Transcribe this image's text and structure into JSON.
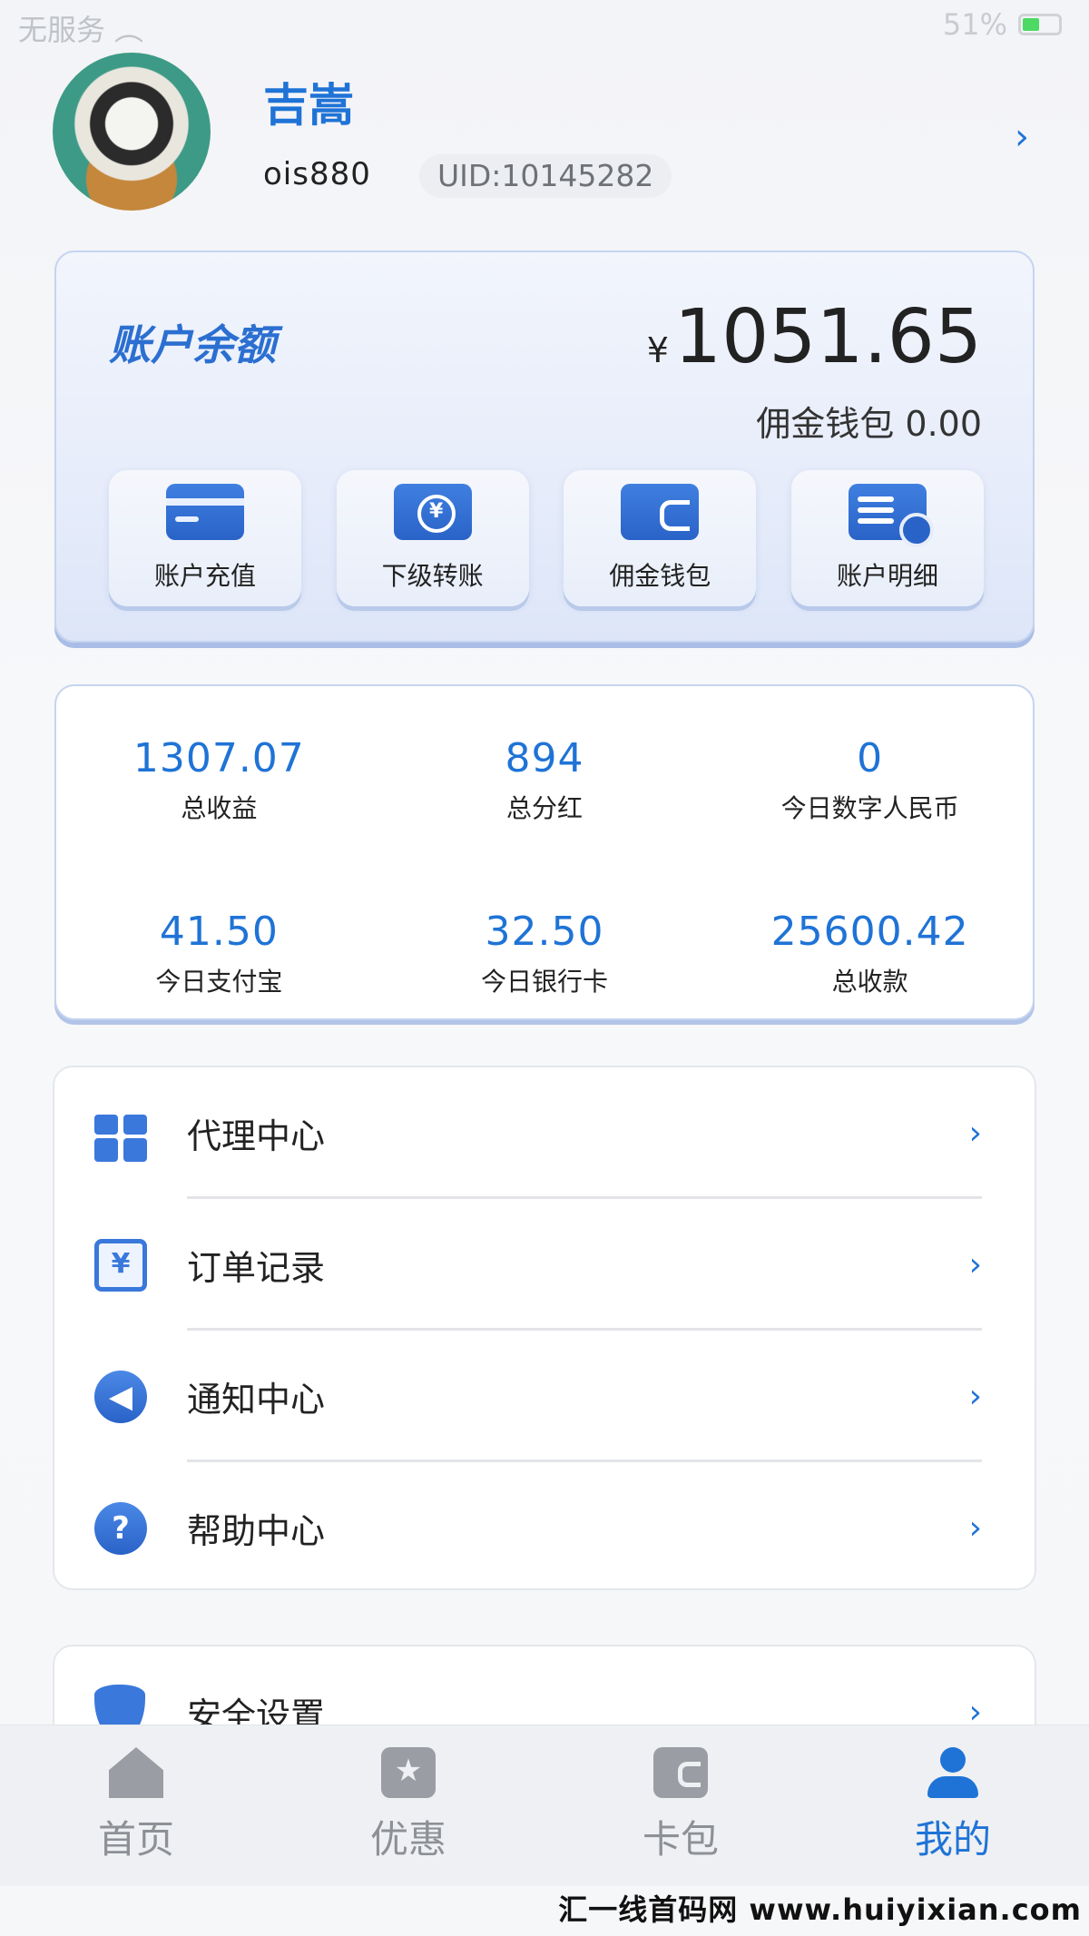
{
  "status_bar": {
    "carrier": "无服务",
    "battery": "51%"
  },
  "profile": {
    "name": "吉嵩",
    "username": "ois880",
    "uid": "UID:10145282"
  },
  "balance": {
    "title": "账户余额",
    "currency": "¥",
    "amount": "1051.65",
    "commission_label": "佣金钱包",
    "commission_value": "0.00",
    "actions": [
      {
        "label": "账户充值",
        "icon": "card-icon"
      },
      {
        "label": "下级转账",
        "icon": "transfer-icon"
      },
      {
        "label": "佣金钱包",
        "icon": "wallet-icon"
      },
      {
        "label": "账户明细",
        "icon": "detail-icon"
      }
    ]
  },
  "stats": [
    {
      "value": "1307.07",
      "label": "总收益"
    },
    {
      "value": "894",
      "label": "总分红"
    },
    {
      "value": "0",
      "label": "今日数字人民币"
    },
    {
      "value": "41.50",
      "label": "今日支付宝"
    },
    {
      "value": "32.50",
      "label": "今日银行卡"
    },
    {
      "value": "25600.42",
      "label": "总收款"
    }
  ],
  "menu": [
    {
      "label": "代理中心",
      "icon": "gift-icon"
    },
    {
      "label": "订单记录",
      "icon": "order-icon"
    },
    {
      "label": "通知中心",
      "icon": "speaker-icon"
    },
    {
      "label": "帮助中心",
      "icon": "help-icon"
    }
  ],
  "security": {
    "label": "安全设置",
    "icon": "shield-icon"
  },
  "tabs": [
    {
      "label": "首页",
      "icon": "home-icon",
      "active": false
    },
    {
      "label": "优惠",
      "icon": "star-icon",
      "active": false
    },
    {
      "label": "卡包",
      "icon": "wallet-icon",
      "active": false
    },
    {
      "label": "我的",
      "icon": "user-icon",
      "active": true
    }
  ],
  "watermark": "汇一线首码网 www.huiyixian.com",
  "colors": {
    "accent": "#1f73d6",
    "card_border": "#c5d4ef",
    "tab_bg": "#eef0f3"
  }
}
